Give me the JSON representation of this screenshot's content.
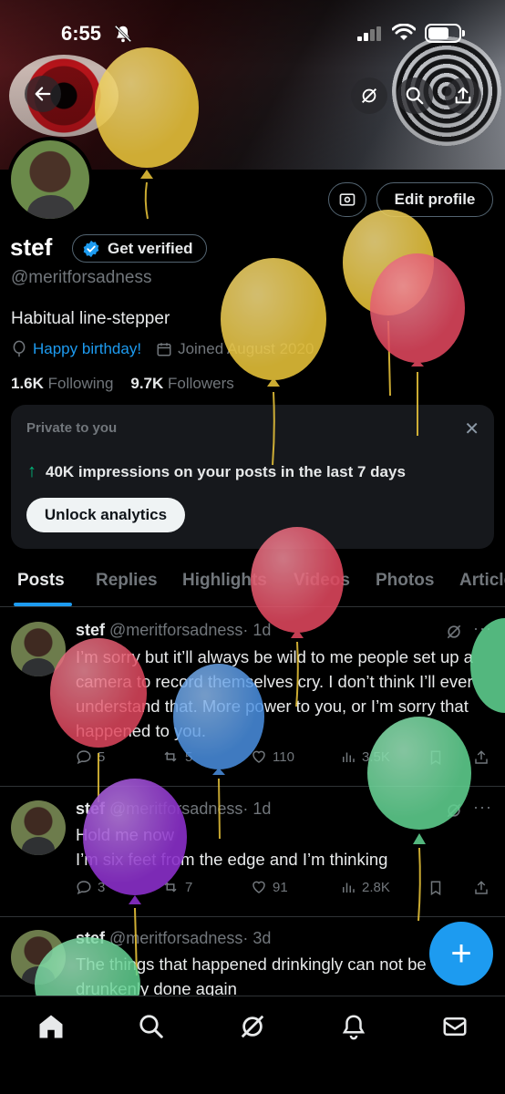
{
  "status": {
    "time": "6:55"
  },
  "profile": {
    "name": "stef",
    "verify_label": "Get verified",
    "handle": "@meritforsadness",
    "bio": "Habitual line-stepper",
    "birthday": "Happy birthday!",
    "joined": "Joined August 2020",
    "following_count": "1.6K",
    "following_label": "Following",
    "followers_count": "9.7K",
    "followers_label": "Followers",
    "edit_label": "Edit profile"
  },
  "private_card": {
    "label": "Private to you",
    "impressions": "40K impressions on your posts in the last 7 days",
    "unlock_label": "Unlock analytics"
  },
  "tabs": [
    "Posts",
    "Replies",
    "Highlights",
    "Videos",
    "Photos",
    "Articles"
  ],
  "posts": [
    {
      "name": "stef",
      "handle": "@meritforsadness",
      "time": "· 1d",
      "text": "I’m sorry but it’ll always be wild to me people set up a camera to record themselves cry. I don’t think I’ll ever understand that. More power to you, or I’m sorry that happened to you.",
      "replies": "5",
      "reposts": "5",
      "likes": "110",
      "views": "3.5K"
    },
    {
      "name": "stef",
      "handle": "@meritforsadness",
      "time": "· 1d",
      "text": "Hold me now\nI’m six feet from the edge and I’m thinking",
      "replies": "3",
      "reposts": "7",
      "likes": "91",
      "views": "2.8K"
    },
    {
      "name": "stef",
      "handle": "@meritforsadness",
      "time": "· 3d",
      "text": "The things that happened drinkingly can not be drunkenly done again"
    }
  ],
  "fab_label": "+",
  "colors": {
    "accent": "#1d9bf0",
    "green": "#00ba7c",
    "balloon_yellow": "#e8c33a",
    "balloon_red": "#e0475e",
    "balloon_blue": "#4a90e2",
    "balloon_purple": "#8a2fc9",
    "balloon_green": "#5fd08f"
  }
}
